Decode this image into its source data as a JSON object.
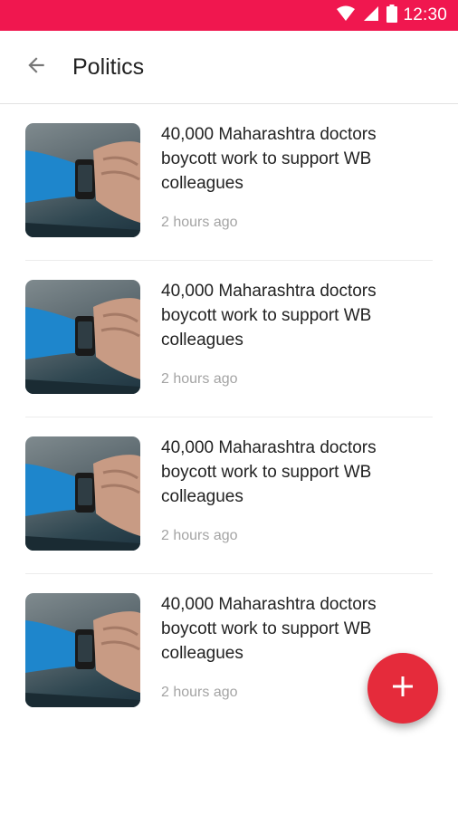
{
  "status_bar": {
    "time": "12:30",
    "icons": [
      "wifi-icon",
      "signal-icon",
      "battery-icon"
    ],
    "color": "#f0174f"
  },
  "app_bar": {
    "back_icon": "arrow-back-icon",
    "title": "Politics"
  },
  "articles": [
    {
      "headline": "40,000 Maharashtra doctors boycott work to support WB colleagues",
      "time_ago": "2 hours ago",
      "thumbnail": "smartwatch-on-wrist"
    },
    {
      "headline": "40,000 Maharashtra doctors boycott work to support WB colleagues",
      "time_ago": "2 hours ago",
      "thumbnail": "smartwatch-on-wrist"
    },
    {
      "headline": "40,000 Maharashtra doctors boycott work to support WB colleagues",
      "time_ago": "2 hours ago",
      "thumbnail": "smartwatch-on-wrist"
    },
    {
      "headline": "40,000 Maharashtra doctors boycott work to support WB colleagues",
      "time_ago": "2 hours ago",
      "thumbnail": "smartwatch-on-wrist"
    }
  ],
  "fab": {
    "icon": "plus-icon",
    "color": "#e52b3b"
  }
}
